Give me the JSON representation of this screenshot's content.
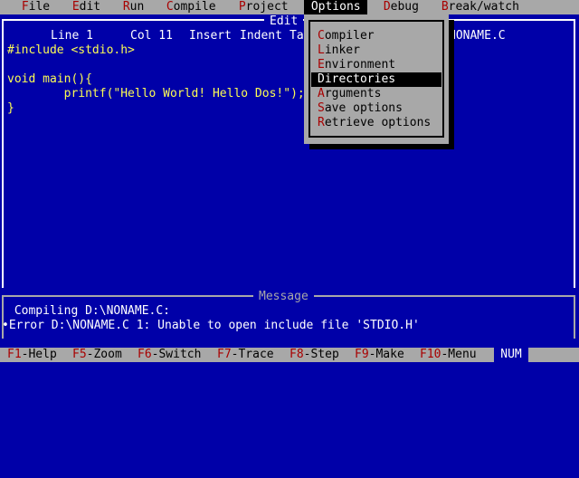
{
  "menubar": {
    "items": [
      {
        "hotkey": "F",
        "rest": "ile"
      },
      {
        "hotkey": "E",
        "rest": "dit"
      },
      {
        "hotkey": "R",
        "rest": "un"
      },
      {
        "hotkey": "C",
        "rest": "ompile"
      },
      {
        "hotkey": "P",
        "rest": "roject"
      },
      {
        "hotkey": "O",
        "rest": "ptions"
      },
      {
        "hotkey": "D",
        "rest": "ebug"
      },
      {
        "hotkey": "B",
        "rest": "reak/watch"
      }
    ]
  },
  "editor": {
    "title": "Edit",
    "line": "Line 1",
    "col": "Col 11",
    "insert": "Insert",
    "indent": "Indent",
    "tab_partial": "Ta",
    "filename": "NONAME.C",
    "code": [
      "#include <stdio.h>",
      "",
      "void main(){",
      "        printf(\"Hello World! Hello Dos!\");",
      "}"
    ]
  },
  "options_menu": {
    "items": [
      {
        "hotkey": "C",
        "rest": "ompiler"
      },
      {
        "hotkey": "L",
        "rest": "inker"
      },
      {
        "hotkey": "E",
        "rest": "nvironment"
      },
      {
        "hotkey": "D",
        "rest": "irectories"
      },
      {
        "hotkey": "A",
        "rest": "rguments"
      },
      {
        "hotkey": "S",
        "rest": "ave options"
      },
      {
        "hotkey": "R",
        "rest": "etrieve options"
      }
    ],
    "selected_index": 3
  },
  "messages": {
    "title": "Message",
    "lines": [
      " Compiling D:\\NONAME.C:",
      "•Error D:\\NONAME.C 1: Unable to open include file 'STDIO.H'"
    ]
  },
  "helpbar": {
    "items": [
      {
        "key": "F1",
        "label": "-Help"
      },
      {
        "key": "F5",
        "label": "-Zoom"
      },
      {
        "key": "F6",
        "label": "-Switch"
      },
      {
        "key": "F7",
        "label": "-Trace"
      },
      {
        "key": "F8",
        "label": "-Step"
      },
      {
        "key": "F9",
        "label": "-Make"
      },
      {
        "key": "F10",
        "label": "-Menu"
      }
    ],
    "num": "NUM"
  },
  "colors": {
    "background": "#0000a8",
    "menu_bg": "#a8a8a8",
    "hotkey": "#a80000",
    "code": "#fcfc54"
  }
}
